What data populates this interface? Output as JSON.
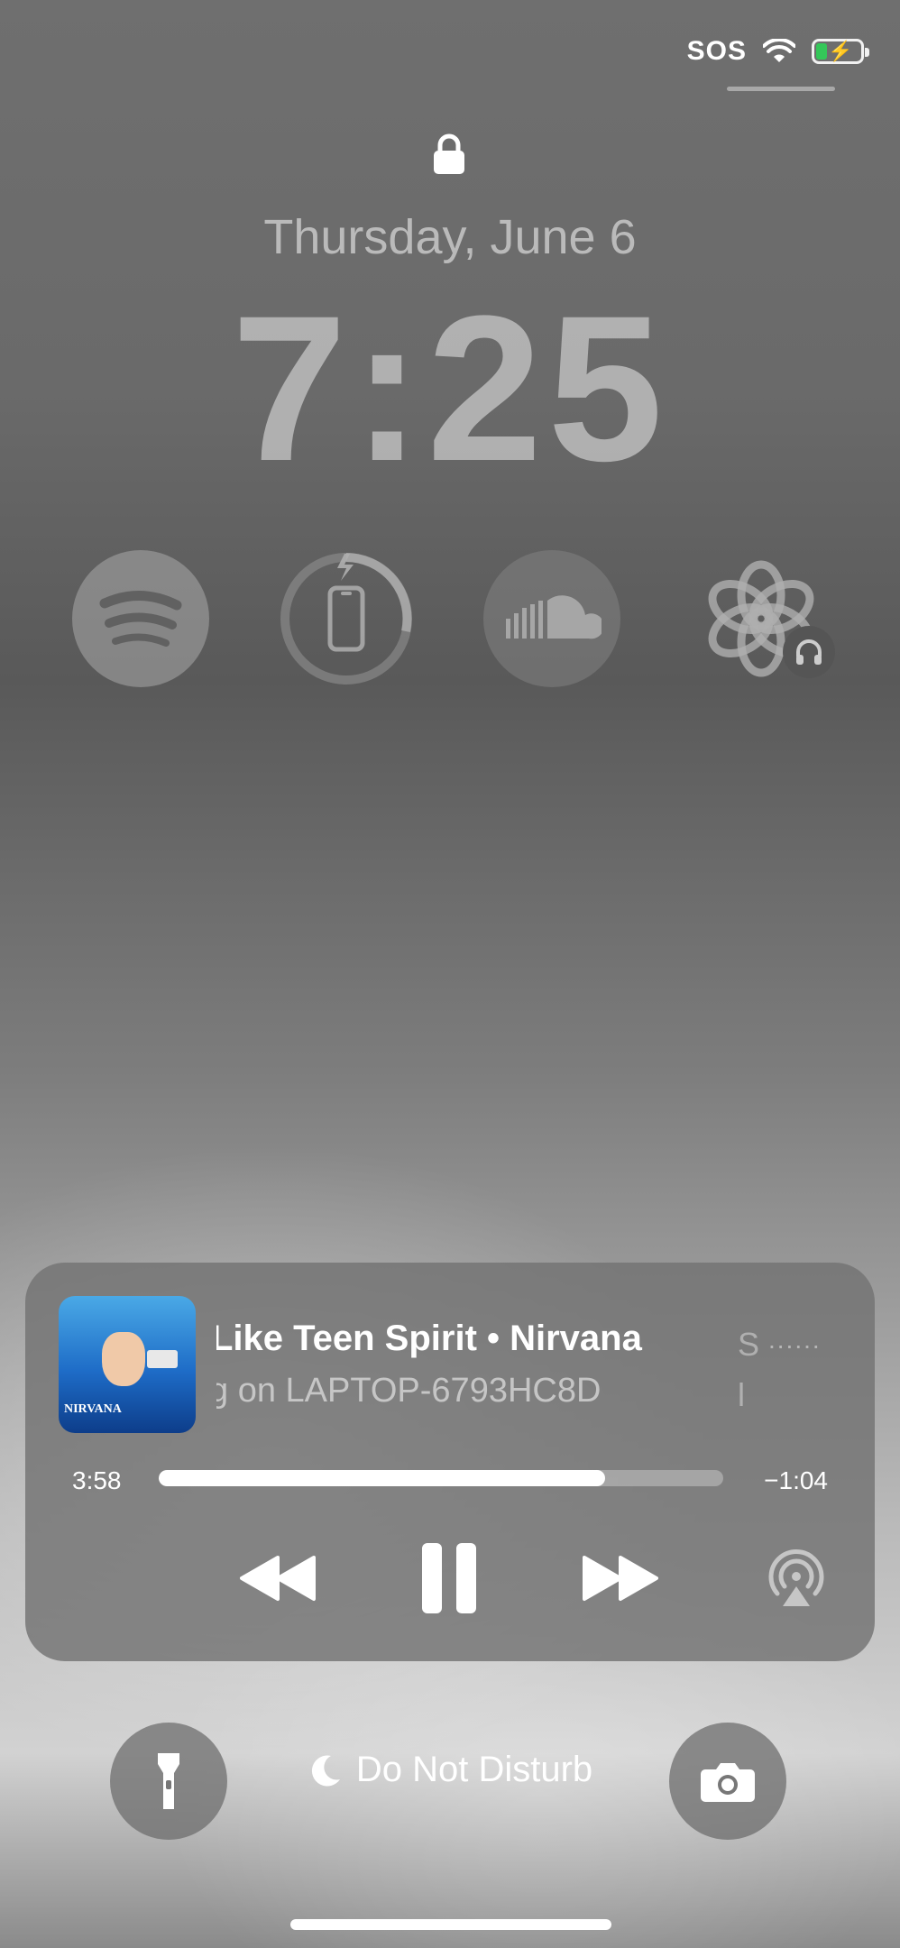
{
  "status_bar": {
    "carrier": "SOS",
    "wifi_icon": "wifi-icon",
    "battery_icon": "battery-charging-icon",
    "battery_fraction": 0.3,
    "battery_color": "#34c759"
  },
  "lock_screen": {
    "lock_icon": "lock-icon",
    "date": "Thursday, June 6",
    "time": "7:25"
  },
  "widgets": [
    {
      "name": "spotify",
      "icon": "spotify-icon"
    },
    {
      "name": "battery",
      "icon": "phone-battery-icon"
    },
    {
      "name": "soundcloud",
      "icon": "soundcloud-icon"
    },
    {
      "name": "openai",
      "icon": "openai-icon",
      "badge": "headphones-icon"
    }
  ],
  "now_playing": {
    "title": "Like Teen Spirit • Nirvana",
    "device": "g on LAPTOP-6793HC8D",
    "ghost_next_title": "S",
    "ghost_next_device": "l",
    "ghost_dots": "......",
    "album_label": "NIRVANA",
    "elapsed": "3:58",
    "remaining": "−1:04",
    "progress": 0.79,
    "controls": {
      "rewind_icon": "rewind-icon",
      "pause_icon": "pause-icon",
      "forward_icon": "fast-forward-icon",
      "airplay_icon": "airplay-audio-icon"
    }
  },
  "bottom_bar": {
    "flashlight_icon": "flashlight-icon",
    "focus_label": "Do Not Disturb",
    "focus_icon": "moon-icon",
    "camera_icon": "camera-icon"
  }
}
